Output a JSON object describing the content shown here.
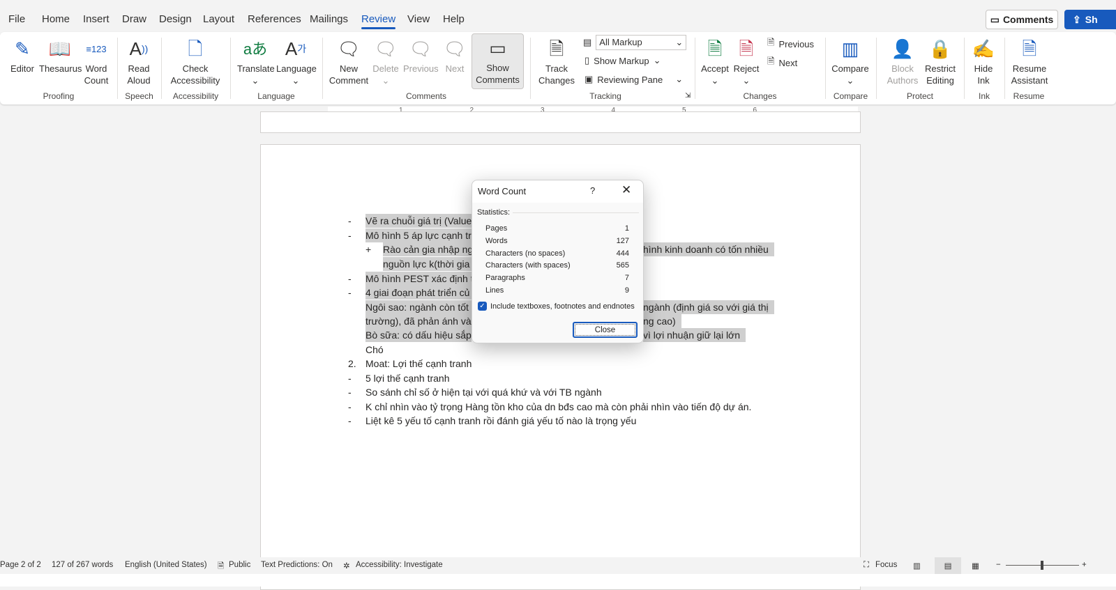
{
  "tabs": [
    "File",
    "Home",
    "Insert",
    "Draw",
    "Design",
    "Layout",
    "References",
    "Mailings",
    "Review",
    "View",
    "Help"
  ],
  "active_tab": "Review",
  "header": {
    "comments_label": "Comments",
    "share_label": "Sh"
  },
  "ribbon": {
    "buttons": {
      "editor": "Editor",
      "thesaurus": "Thesaurus",
      "word_count": "Word Count",
      "read_aloud": "Read Aloud",
      "check_accessibility": "Check Accessibility",
      "translate": "Translate",
      "language": "Language",
      "new_comment": "New Comment",
      "delete": "Delete",
      "previous": "Previous",
      "next": "Next",
      "show_comments": "Show Comments",
      "track_changes": "Track Changes",
      "accept": "Accept",
      "reject": "Reject",
      "compare": "Compare",
      "block_authors": "Block Authors",
      "restrict_editing": "Restrict Editing",
      "hide_ink": "Hide Ink",
      "resume_assistant": "Resume Assistant"
    },
    "tracking": {
      "markup_select": "All Markup",
      "show_markup": "Show Markup",
      "reviewing_pane": "Reviewing Pane"
    },
    "changes": {
      "previous": "Previous",
      "next": "Next"
    },
    "groups": {
      "proofing": "Proofing",
      "speech": "Speech",
      "accessibility": "Accessibility",
      "language": "Language",
      "comments": "Comments",
      "tracking": "Tracking",
      "changes": "Changes",
      "compare": "Compare",
      "protect": "Protect",
      "ink": "Ink",
      "resume": "Resume"
    }
  },
  "ruler": [
    "1",
    "2",
    "3",
    "4",
    "5",
    "6"
  ],
  "document": {
    "lines": [
      {
        "marker": "-",
        "left": "Vẽ ra chuỗi giá trị (Value",
        "right": "",
        "hl": true
      },
      {
        "marker": "-",
        "left": "Mô hình 5 áp lực cạnh tr",
        "right": "",
        "hl": true
      },
      {
        "marker": "+",
        "left": "Rào cản gia nhập ng",
        "right": "hình kinh doanh có tốn nhiều",
        "hl": true,
        "indent": true
      },
      {
        "marker": "",
        "left": "nguồn lực k(thời gia",
        "right": "",
        "hl": true,
        "indent": true
      },
      {
        "marker": "-",
        "left": "Mô hình PEST xác định t",
        "right": "",
        "hl": true
      },
      {
        "marker": "-",
        "left": "4 giai đoạn phát triển củ",
        "right": "",
        "hl": true
      },
      {
        "marker": "",
        "left": "Ngôi sao: ngành còn tốt",
        "right": "ngành (định giá so với giá thị",
        "hl": true
      },
      {
        "marker": "",
        "left": "trường), đã phản ánh và",
        "right": "ng cao)",
        "hl": true
      },
      {
        "marker": "",
        "left": "Bò sữa: có dấu hiệu sắp",
        "right": "vì lợi nhuận giữ lại lớn",
        "hl": true
      },
      {
        "marker": "",
        "left": "Chó",
        "right": "",
        "hl": false
      },
      {
        "marker": "2.",
        "left": "Moat: Lợi thế cạnh tranh",
        "right": "",
        "hl": false
      },
      {
        "marker": "-",
        "left": "5 lợi thế cạnh tranh",
        "right": "",
        "hl": false
      },
      {
        "marker": "-",
        "left": "So sánh chỉ số ở hiện tại với quá khứ và với TB ngành",
        "right": "",
        "hl": false
      },
      {
        "marker": "-",
        "left": "K chỉ nhìn vào tỷ trọng Hàng tồn kho của dn bđs cao mà còn phải nhìn vào tiến độ dự án.",
        "right": "",
        "hl": false
      },
      {
        "marker": "-",
        "left": "Liệt kê 5 yếu tố cạnh tranh rồi đánh giá yếu tố nào là trọng yếu",
        "right": "",
        "hl": false
      }
    ]
  },
  "dialog": {
    "title": "Word Count",
    "help": "?",
    "section": "Statistics:",
    "stats": [
      {
        "label": "Pages",
        "value": "1"
      },
      {
        "label": "Words",
        "value": "127"
      },
      {
        "label": "Characters (no spaces)",
        "value": "444"
      },
      {
        "label": "Characters (with spaces)",
        "value": "565"
      },
      {
        "label": "Paragraphs",
        "value": "7"
      },
      {
        "label": "Lines",
        "value": "9"
      }
    ],
    "include_label": "Include textboxes, footnotes and endnotes",
    "include_checked": true,
    "close_label": "Close"
  },
  "status": {
    "page": "Page 2 of 2",
    "words": "127 of 267 words",
    "language": "English (United States)",
    "sensitivity": "Public",
    "text_predictions": "Text Predictions: On",
    "accessibility": "Accessibility: Investigate",
    "focus": "Focus"
  },
  "colors": {
    "accent": "#185abd",
    "highlight": "#cfcfcf"
  }
}
